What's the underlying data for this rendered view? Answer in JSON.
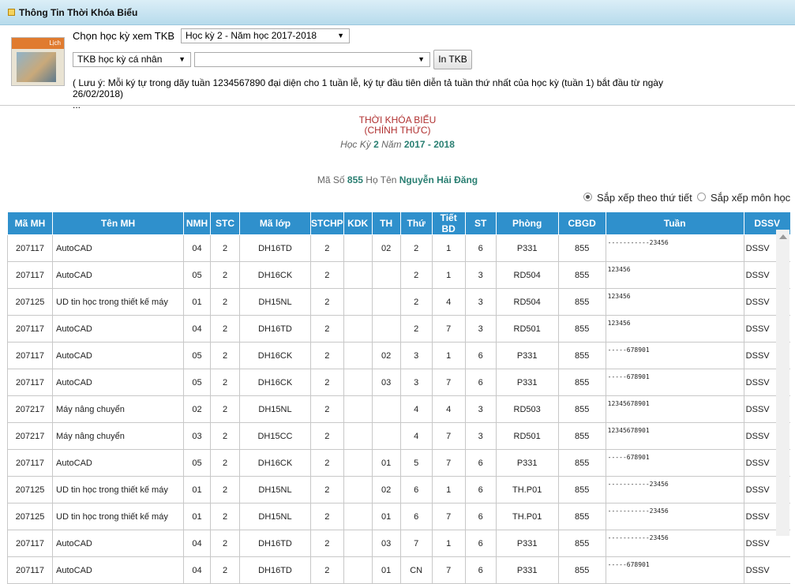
{
  "panel": {
    "title": "Thông Tin Thời Khóa Biểu",
    "icon": "window-icon"
  },
  "calendar_icon": {
    "label": "Lịch"
  },
  "controls": {
    "choose_label": "Chọn học kỳ xem TKB",
    "semester_select": "Học kỳ 2 - Năm học 2017-2018",
    "type_select": "TKB học kỳ cá nhân",
    "third_select": "",
    "print_button": "In TKB",
    "note": "( Lưu ý: Mỗi ký tự trong dãy tuần 1234567890 đại diện cho 1 tuần lễ, ký tự đầu tiên diễn tả tuần thứ nhất của học kỳ (tuần 1) bắt đầu từ ngày 26/02/2018)",
    "note_more": "..."
  },
  "header": {
    "title": "THỜI KHÓA BIỂU",
    "subtitle": "(CHÍNH THỨC)",
    "hk_label": "Học Kỳ",
    "hk_value": "2",
    "year_label": "Năm",
    "year_value": "2017 - 2018",
    "ms_label": "Mã Số",
    "ms_value": "855",
    "name_label": "Họ Tên",
    "name_value": "Nguyễn Hải Đăng"
  },
  "sort": {
    "option1": "Sắp xếp theo thứ tiết",
    "option2": "Sắp xếp môn học",
    "selected": "option1"
  },
  "table": {
    "columns": [
      "Mã MH",
      "Tên MH",
      "NMH",
      "STC",
      "Mã lớp",
      "STCHP",
      "KDK",
      "TH",
      "Thứ",
      "Tiết BD",
      "ST",
      "Phòng",
      "CBGD",
      "Tuần",
      "DSSV"
    ],
    "rows": [
      [
        "207117",
        "AutoCAD",
        "04",
        "2",
        "DH16TD",
        "2",
        "",
        "02",
        "2",
        "1",
        "6",
        "P331",
        "855",
        "-----------23456",
        "DSSV"
      ],
      [
        "207117",
        "AutoCAD",
        "05",
        "2",
        "DH16CK",
        "2",
        "",
        "",
        "2",
        "1",
        "3",
        "RD504",
        "855",
        "123456",
        "DSSV"
      ],
      [
        "207125",
        "UD tin học trong thiết kế máy",
        "01",
        "2",
        "DH15NL",
        "2",
        "",
        "",
        "2",
        "4",
        "3",
        "RD504",
        "855",
        "123456",
        "DSSV"
      ],
      [
        "207117",
        "AutoCAD",
        "04",
        "2",
        "DH16TD",
        "2",
        "",
        "",
        "2",
        "7",
        "3",
        "RD501",
        "855",
        "123456",
        "DSSV"
      ],
      [
        "207117",
        "AutoCAD",
        "05",
        "2",
        "DH16CK",
        "2",
        "",
        "02",
        "3",
        "1",
        "6",
        "P331",
        "855",
        "-----678901",
        "DSSV"
      ],
      [
        "207117",
        "AutoCAD",
        "05",
        "2",
        "DH16CK",
        "2",
        "",
        "03",
        "3",
        "7",
        "6",
        "P331",
        "855",
        "-----678901",
        "DSSV"
      ],
      [
        "207217",
        "Máy nâng chuyển",
        "02",
        "2",
        "DH15NL",
        "2",
        "",
        "",
        "4",
        "4",
        "3",
        "RD503",
        "855",
        "12345678901",
        "DSSV"
      ],
      [
        "207217",
        "Máy nâng chuyển",
        "03",
        "2",
        "DH15CC",
        "2",
        "",
        "",
        "4",
        "7",
        "3",
        "RD501",
        "855",
        "12345678901",
        "DSSV"
      ],
      [
        "207117",
        "AutoCAD",
        "05",
        "2",
        "DH16CK",
        "2",
        "",
        "01",
        "5",
        "7",
        "6",
        "P331",
        "855",
        "-----678901",
        "DSSV"
      ],
      [
        "207125",
        "UD tin học trong thiết kế máy",
        "01",
        "2",
        "DH15NL",
        "2",
        "",
        "02",
        "6",
        "1",
        "6",
        "TH.P01",
        "855",
        "-----------23456",
        "DSSV"
      ],
      [
        "207125",
        "UD tin học trong thiết kế máy",
        "01",
        "2",
        "DH15NL",
        "2",
        "",
        "01",
        "6",
        "7",
        "6",
        "TH.P01",
        "855",
        "-----------23456",
        "DSSV"
      ],
      [
        "207117",
        "AutoCAD",
        "04",
        "2",
        "DH16TD",
        "2",
        "",
        "03",
        "7",
        "1",
        "6",
        "P331",
        "855",
        "-----------23456",
        "DSSV"
      ],
      [
        "207117",
        "AutoCAD",
        "04",
        "2",
        "DH16TD",
        "2",
        "",
        "01",
        "CN",
        "7",
        "6",
        "P331",
        "855",
        "-----678901",
        "DSSV"
      ]
    ]
  }
}
